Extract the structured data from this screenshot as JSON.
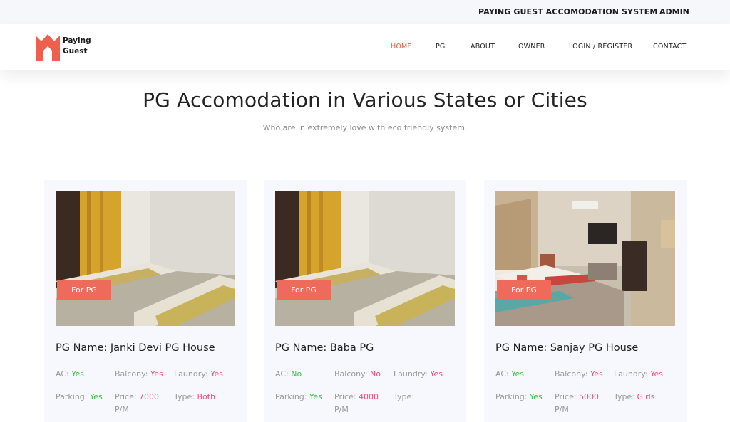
{
  "topbar": {
    "site_name": "PAYING GUEST ACCOMODATION SYSTEM",
    "admin": "ADMIN"
  },
  "logo": {
    "line1": "Paying",
    "line2": "Guest",
    "color": "#ee5f4c"
  },
  "nav": {
    "items": [
      "HOME",
      "PG",
      "ABOUT",
      "OWNER",
      "LOGIN / REGISTER",
      "CONTACT"
    ],
    "active": "HOME"
  },
  "hero": {
    "title": "PG Accomodation in Various States or Cities",
    "subtitle": "Who are in extremely love with eco friendly system."
  },
  "colors": {
    "accent": "#ee5f4c",
    "yes_green": "#3cc142",
    "value_pink": "#ef4f7a",
    "card_bg": "#f7f8fd"
  },
  "cards": [
    {
      "tag": "For PG",
      "name": "PG Name: Janki Devi PG House",
      "ac_label": "AC:",
      "ac": "Yes",
      "balcony_label": "Balcony:",
      "balcony": "Yes",
      "laundry_label": "Laundry:",
      "laundry": "Yes",
      "parking_label": "Parking:",
      "parking": "Yes",
      "price_label": "Price:",
      "price": "7000",
      "price_unit": "P/M",
      "type_label": "Type:",
      "type": "Both"
    },
    {
      "tag": "For PG",
      "name": "PG Name: Baba PG",
      "ac_label": "AC:",
      "ac": "No",
      "balcony_label": "Balcony:",
      "balcony": "No",
      "laundry_label": "Laundry:",
      "laundry": "Yes",
      "parking_label": "Parking:",
      "parking": "Yes",
      "price_label": "Price:",
      "price": "4000",
      "price_unit": "P/M",
      "type_label": "Type:",
      "type": ""
    },
    {
      "tag": "For PG",
      "name": "PG Name: Sanjay PG House",
      "ac_label": "AC:",
      "ac": "Yes",
      "balcony_label": "Balcony:",
      "balcony": "Yes",
      "laundry_label": "Laundry:",
      "laundry": "Yes",
      "parking_label": "Parking:",
      "parking": "Yes",
      "price_label": "Price:",
      "price": "5000",
      "price_unit": "P/M",
      "type_label": "Type:",
      "type": "Girls"
    }
  ]
}
